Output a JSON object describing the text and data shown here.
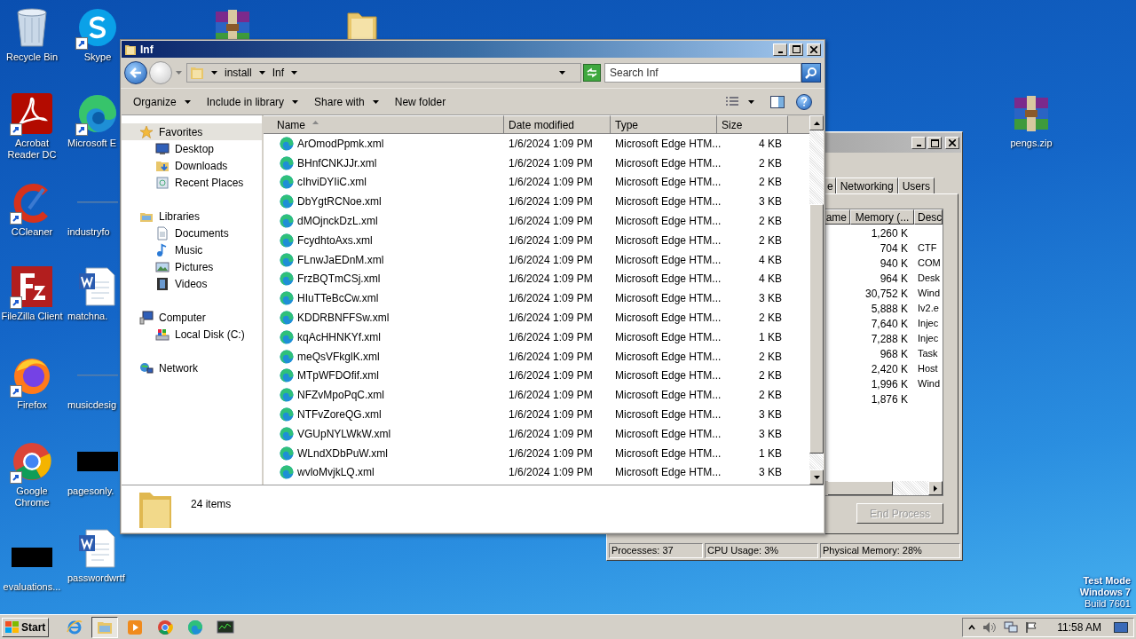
{
  "desktop_icons": [
    {
      "kind": "recycle",
      "label": "Recycle Bin",
      "shortcut": false
    },
    {
      "kind": "acrobat",
      "label": "Acrobat Reader DC",
      "shortcut": true
    },
    {
      "kind": "ccleaner",
      "label": "CCleaner",
      "shortcut": true
    },
    {
      "kind": "filezilla",
      "label": "FileZilla Client",
      "shortcut": true
    },
    {
      "kind": "firefox",
      "label": "Firefox",
      "shortcut": true
    },
    {
      "kind": "chrome",
      "label": "Google Chrome",
      "shortcut": true
    },
    {
      "kind": "black",
      "label": "evaluations...",
      "shortcut": false
    },
    {
      "kind": "skype",
      "label": "Skype",
      "shortcut": true
    },
    {
      "kind": "edge",
      "label": "Microsoft E",
      "shortcut": true
    },
    {
      "kind": "blank",
      "label": "industryfo",
      "shortcut": false
    },
    {
      "kind": "word",
      "label": "matchna.",
      "shortcut": false
    },
    {
      "kind": "blank",
      "label": "musicdesig",
      "shortcut": false
    },
    {
      "kind": "black",
      "label": "pagesonly.",
      "shortcut": false
    },
    {
      "kind": "word",
      "label": "passwordwrtf",
      "shortcut": false
    },
    {
      "kind": "archive",
      "shortcut": false
    },
    {
      "kind": "folder",
      "shortcut": false
    },
    {
      "kind": "archive",
      "label": "pengs.zip",
      "shortcut": false
    }
  ],
  "task_manager": {
    "tabs": [
      {
        "label": "e",
        "selected": false
      },
      {
        "label": "Networking",
        "selected": false
      },
      {
        "label": "Users",
        "selected": false
      }
    ],
    "columns": [
      "ame",
      "Memory (...",
      "Desc"
    ],
    "rows": [
      {
        "memory": "1,260 K"
      },
      {
        "memory": "704 K",
        "description": "CTF"
      },
      {
        "memory": "940 K",
        "description": "COM"
      },
      {
        "memory": "964 K",
        "description": "Desk"
      },
      {
        "memory": "30,752 K",
        "description": "Wind"
      },
      {
        "memory": "5,888 K",
        "description": "Iv2.e"
      },
      {
        "memory": "7,640 K",
        "description": "Injec"
      },
      {
        "memory": "7,288 K",
        "description": "Injec"
      },
      {
        "memory": "968 K",
        "description": "Task"
      },
      {
        "memory": "2,420 K",
        "description": "Host"
      },
      {
        "memory": "1,996 K",
        "description": "Wind"
      },
      {
        "memory": "1,876 K"
      }
    ],
    "end_button": {
      "label": "End Process",
      "disabled": true
    },
    "status": [
      "Processes: 37",
      "CPU Usage: 3%",
      "Physical Memory: 28%"
    ]
  },
  "explorer": {
    "title": "Inf",
    "breadcrumb": [
      "install",
      "Inf"
    ],
    "search": {
      "placeholder": "Search Inf"
    },
    "toolbar": [
      {
        "label": "Organize",
        "dropdown": true
      },
      {
        "label": "Include in library",
        "dropdown": true
      },
      {
        "label": "Share with",
        "dropdown": true
      },
      {
        "label": "New folder",
        "dropdown": false
      }
    ],
    "nav": [
      {
        "kind": "star",
        "label": "Favorites",
        "selected": true,
        "children": [
          {
            "kind": "desktop",
            "label": "Desktop",
            "selected": false
          },
          {
            "kind": "downloads",
            "label": "Downloads",
            "selected": false
          },
          {
            "kind": "recent",
            "label": "Recent Places",
            "selected": false
          }
        ]
      },
      {
        "kind": "libraries",
        "label": "Libraries",
        "selected": false,
        "children": [
          {
            "kind": "documents",
            "label": "Documents",
            "selected": false
          },
          {
            "kind": "music",
            "label": "Music",
            "selected": false
          },
          {
            "kind": "pictures",
            "label": "Pictures",
            "selected": false
          },
          {
            "kind": "videos",
            "label": "Videos",
            "selected": false
          }
        ]
      },
      {
        "kind": "computer",
        "label": "Computer",
        "selected": false,
        "children": [
          {
            "kind": "disk",
            "label": "Local Disk (C:)",
            "selected": false
          }
        ]
      },
      {
        "kind": "network",
        "label": "Network",
        "selected": false
      }
    ],
    "columns": [
      {
        "label": "Name",
        "sorted": true
      },
      {
        "label": "Date modified",
        "sorted": false
      },
      {
        "label": "Type",
        "sorted": false
      },
      {
        "label": "Size",
        "sorted": false
      }
    ],
    "rows": [
      {
        "name": "ArOmodPpmk.xml",
        "date": "1/6/2024 1:09 PM",
        "type": "Microsoft Edge HTM...",
        "size": "4 KB"
      },
      {
        "name": "BHnfCNKJJr.xml",
        "date": "1/6/2024 1:09 PM",
        "type": "Microsoft Edge HTM...",
        "size": "2 KB"
      },
      {
        "name": "cIhviDYIiC.xml",
        "date": "1/6/2024 1:09 PM",
        "type": "Microsoft Edge HTM...",
        "size": "2 KB"
      },
      {
        "name": "DbYgtRCNoe.xml",
        "date": "1/6/2024 1:09 PM",
        "type": "Microsoft Edge HTM...",
        "size": "3 KB"
      },
      {
        "name": "dMOjnckDzL.xml",
        "date": "1/6/2024 1:09 PM",
        "type": "Microsoft Edge HTM...",
        "size": "2 KB"
      },
      {
        "name": "FcydhtoAxs.xml",
        "date": "1/6/2024 1:09 PM",
        "type": "Microsoft Edge HTM...",
        "size": "2 KB"
      },
      {
        "name": "FLnwJaEDnM.xml",
        "date": "1/6/2024 1:09 PM",
        "type": "Microsoft Edge HTM...",
        "size": "4 KB"
      },
      {
        "name": "FrzBQTmCSj.xml",
        "date": "1/6/2024 1:09 PM",
        "type": "Microsoft Edge HTM...",
        "size": "4 KB"
      },
      {
        "name": "HIuTTeBcCw.xml",
        "date": "1/6/2024 1:09 PM",
        "type": "Microsoft Edge HTM...",
        "size": "3 KB"
      },
      {
        "name": "KDDRBNFFSw.xml",
        "date": "1/6/2024 1:09 PM",
        "type": "Microsoft Edge HTM...",
        "size": "2 KB"
      },
      {
        "name": "kqAcHHNKYf.xml",
        "date": "1/6/2024 1:09 PM",
        "type": "Microsoft Edge HTM...",
        "size": "1 KB"
      },
      {
        "name": "meQsVFkglK.xml",
        "date": "1/6/2024 1:09 PM",
        "type": "Microsoft Edge HTM...",
        "size": "2 KB"
      },
      {
        "name": "MTpWFDOfif.xml",
        "date": "1/6/2024 1:09 PM",
        "type": "Microsoft Edge HTM...",
        "size": "2 KB"
      },
      {
        "name": "NFZvMpoPqC.xml",
        "date": "1/6/2024 1:09 PM",
        "type": "Microsoft Edge HTM...",
        "size": "2 KB"
      },
      {
        "name": "NTFvZoreQG.xml",
        "date": "1/6/2024 1:09 PM",
        "type": "Microsoft Edge HTM...",
        "size": "3 KB"
      },
      {
        "name": "VGUpNYLWkW.xml",
        "date": "1/6/2024 1:09 PM",
        "type": "Microsoft Edge HTM...",
        "size": "3 KB"
      },
      {
        "name": "WLndXDbPuW.xml",
        "date": "1/6/2024 1:09 PM",
        "type": "Microsoft Edge HTM...",
        "size": "1 KB"
      },
      {
        "name": "wvloMvjkLQ.xml",
        "date": "1/6/2024 1:09 PM",
        "type": "Microsoft Edge HTM...",
        "size": "3 KB"
      }
    ],
    "status": "24 items"
  },
  "os_notice": [
    {
      "text": "Test Mode",
      "bold": true
    },
    {
      "text": "Windows 7",
      "bold": true
    },
    {
      "text": "Build 7601",
      "bold": false
    }
  ],
  "taskbar": {
    "start": "Start",
    "apps": [
      {
        "kind": "ie",
        "active": false
      },
      {
        "kind": "explorer",
        "active": true
      },
      {
        "kind": "media",
        "active": false
      },
      {
        "kind": "chrome",
        "active": false
      },
      {
        "kind": "edge",
        "active": false
      },
      {
        "kind": "taskmgr",
        "active": false
      }
    ],
    "clock": "11:58 AM"
  }
}
